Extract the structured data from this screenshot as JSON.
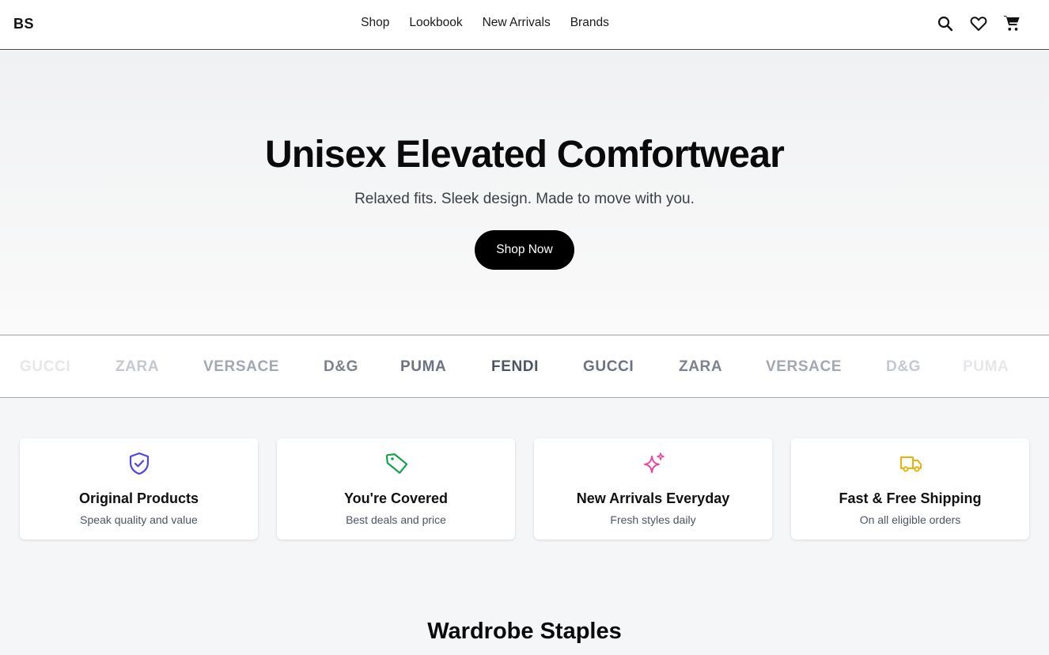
{
  "header": {
    "logo": "BS",
    "nav": [
      "Shop",
      "Lookbook",
      "New Arrivals",
      "Brands"
    ],
    "icons": [
      "search-icon",
      "heart-icon",
      "cart-icon"
    ]
  },
  "hero": {
    "title": "Unisex Elevated Comfortwear",
    "subtitle": "Relaxed fits. Sleek design. Made to move with you.",
    "cta": "Shop Now"
  },
  "brands": [
    "GUCCI",
    "ZARA",
    "VERSACE",
    "D&G",
    "PUMA",
    "FENDI",
    "GUCCI",
    "ZARA",
    "VERSACE",
    "D&G",
    "PUMA"
  ],
  "features": [
    {
      "icon": "shield-check-icon",
      "color": "#4f46e5",
      "title": "Original Products",
      "subtitle": "Speak quality and value"
    },
    {
      "icon": "tag-icon",
      "color": "#16a34a",
      "title": "You're Covered",
      "subtitle": "Best deals and price"
    },
    {
      "icon": "sparkles-icon",
      "color": "#ec4899",
      "title": "New Arrivals Everyday",
      "subtitle": "Fresh styles daily"
    },
    {
      "icon": "truck-icon",
      "color": "#eab308",
      "title": "Fast & Free Shipping",
      "subtitle": "On all eligible orders"
    }
  ],
  "section": {
    "title": "Wardrobe Staples"
  }
}
